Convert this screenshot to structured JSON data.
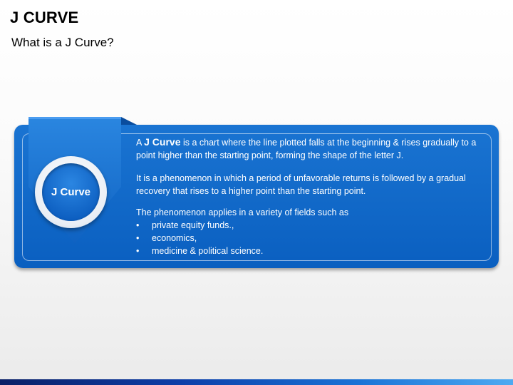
{
  "slide": {
    "title": "J CURVE",
    "subtitle": "What is a J Curve?"
  },
  "badge": {
    "label": "J Curve"
  },
  "content": {
    "p1_prefix": "A ",
    "p1_term": "J Curve",
    "p1_rest": " is a chart where the line plotted falls at the beginning & rises gradually to a point higher than the starting point, forming the shape of the letter J.",
    "p2": "It is a phenomenon in which a period of unfavorable returns is followed by a gradual recovery that rises to a higher point than the starting point.",
    "p3_intro": "The phenomenon applies in a variety of fields such as",
    "bullets": [
      "private equity funds.,",
      "economics,",
      "medicine & political science."
    ],
    "bullet_symbol": "•"
  },
  "colors": {
    "panel_blue": "#0a5fc0",
    "ribbon_blue": "#1a74d2",
    "text_white": "#ffffff"
  }
}
